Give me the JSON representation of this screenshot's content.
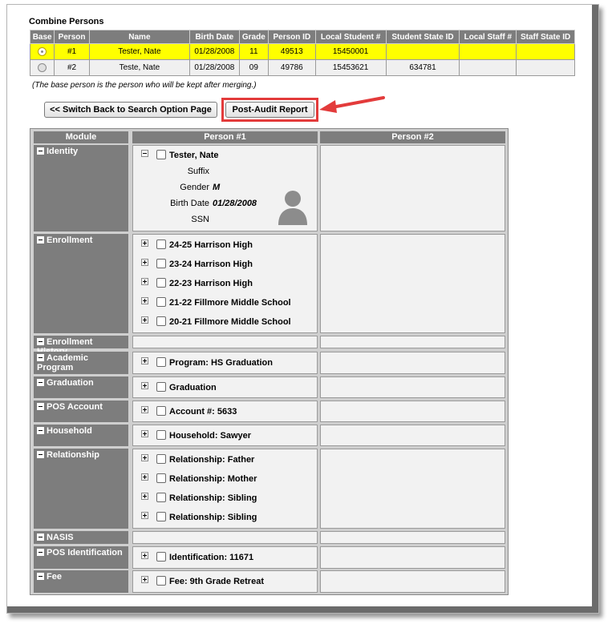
{
  "combine": {
    "title": "Combine Persons",
    "columns": [
      "Base",
      "Person",
      "Name",
      "Birth Date",
      "Grade",
      "Person ID",
      "Local Student #",
      "Student State ID",
      "Local Staff #",
      "Staff State ID"
    ],
    "rows": [
      {
        "person": "#1",
        "name": "Tester, Nate",
        "birth": "01/28/2008",
        "grade": "11",
        "pid": "49513",
        "local_student": "15450001",
        "state_id": "",
        "local_staff": "",
        "staff_state": "",
        "selected": true
      },
      {
        "person": "#2",
        "name": "Teste, Nate",
        "birth": "01/28/2008",
        "grade": "09",
        "pid": "49786",
        "local_student": "15453621",
        "state_id": "634781",
        "local_staff": "",
        "staff_state": "",
        "selected": false
      }
    ],
    "note": "(The base person is the person who will be kept after merging.)",
    "highlight_color": "#ffff00"
  },
  "buttons": {
    "back": "<< Switch Back to Search Option Page",
    "audit": "Post-Audit Report"
  },
  "annotation": {
    "color": "#e33b3b"
  },
  "merge": {
    "headers": [
      "Module",
      "Person #1",
      "Person #2"
    ],
    "identity": {
      "module": "Identity",
      "name": "Tester, Nate",
      "fields": [
        {
          "label": "Suffix",
          "value": ""
        },
        {
          "label": "Gender",
          "value": "M"
        },
        {
          "label": "Birth Date",
          "value": "01/28/2008"
        },
        {
          "label": "SSN",
          "value": ""
        }
      ]
    },
    "modules": [
      {
        "module": "Enrollment",
        "items": [
          "24-25 Harrison High",
          "23-24 Harrison High",
          "22-23 Harrison High",
          "21-22 Fillmore Middle School",
          "20-21 Fillmore Middle School"
        ]
      },
      {
        "module": "Enrollment History",
        "items": []
      },
      {
        "module": "Academic Program",
        "items": [
          "Program: HS Graduation"
        ]
      },
      {
        "module": "Graduation",
        "items": [
          "Graduation"
        ]
      },
      {
        "module": "POS Account",
        "items": [
          "Account #: 5633"
        ]
      },
      {
        "module": "Household",
        "items": [
          "Household: Sawyer"
        ]
      },
      {
        "module": "Relationship",
        "items": [
          "Relationship: Father",
          "Relationship: Mother",
          "Relationship: Sibling",
          "Relationship: Sibling"
        ]
      },
      {
        "module": "NASIS",
        "items": []
      },
      {
        "module": "POS Identification",
        "items": [
          "Identification: 11671"
        ]
      },
      {
        "module": "Fee",
        "items": [
          "Fee: 9th Grade Retreat"
        ]
      }
    ]
  }
}
